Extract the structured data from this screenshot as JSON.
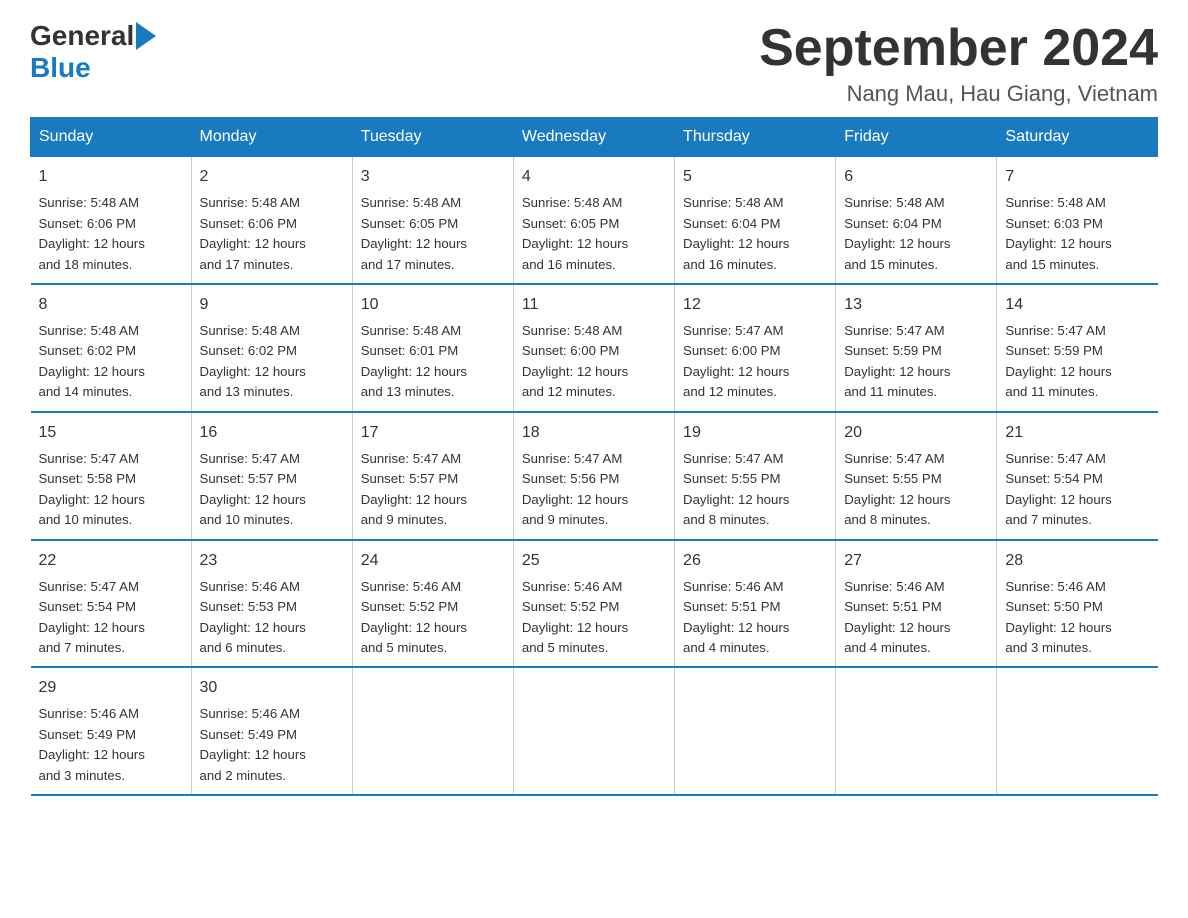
{
  "logo": {
    "text_general": "General",
    "text_blue": "Blue",
    "arrow_symbol": "▶"
  },
  "title": "September 2024",
  "subtitle": "Nang Mau, Hau Giang, Vietnam",
  "days_of_week": [
    "Sunday",
    "Monday",
    "Tuesday",
    "Wednesday",
    "Thursday",
    "Friday",
    "Saturday"
  ],
  "weeks": [
    [
      {
        "day": "1",
        "sunrise": "5:48 AM",
        "sunset": "6:06 PM",
        "daylight": "12 hours and 18 minutes."
      },
      {
        "day": "2",
        "sunrise": "5:48 AM",
        "sunset": "6:06 PM",
        "daylight": "12 hours and 17 minutes."
      },
      {
        "day": "3",
        "sunrise": "5:48 AM",
        "sunset": "6:05 PM",
        "daylight": "12 hours and 17 minutes."
      },
      {
        "day": "4",
        "sunrise": "5:48 AM",
        "sunset": "6:05 PM",
        "daylight": "12 hours and 16 minutes."
      },
      {
        "day": "5",
        "sunrise": "5:48 AM",
        "sunset": "6:04 PM",
        "daylight": "12 hours and 16 minutes."
      },
      {
        "day": "6",
        "sunrise": "5:48 AM",
        "sunset": "6:04 PM",
        "daylight": "12 hours and 15 minutes."
      },
      {
        "day": "7",
        "sunrise": "5:48 AM",
        "sunset": "6:03 PM",
        "daylight": "12 hours and 15 minutes."
      }
    ],
    [
      {
        "day": "8",
        "sunrise": "5:48 AM",
        "sunset": "6:02 PM",
        "daylight": "12 hours and 14 minutes."
      },
      {
        "day": "9",
        "sunrise": "5:48 AM",
        "sunset": "6:02 PM",
        "daylight": "12 hours and 13 minutes."
      },
      {
        "day": "10",
        "sunrise": "5:48 AM",
        "sunset": "6:01 PM",
        "daylight": "12 hours and 13 minutes."
      },
      {
        "day": "11",
        "sunrise": "5:48 AM",
        "sunset": "6:00 PM",
        "daylight": "12 hours and 12 minutes."
      },
      {
        "day": "12",
        "sunrise": "5:47 AM",
        "sunset": "6:00 PM",
        "daylight": "12 hours and 12 minutes."
      },
      {
        "day": "13",
        "sunrise": "5:47 AM",
        "sunset": "5:59 PM",
        "daylight": "12 hours and 11 minutes."
      },
      {
        "day": "14",
        "sunrise": "5:47 AM",
        "sunset": "5:59 PM",
        "daylight": "12 hours and 11 minutes."
      }
    ],
    [
      {
        "day": "15",
        "sunrise": "5:47 AM",
        "sunset": "5:58 PM",
        "daylight": "12 hours and 10 minutes."
      },
      {
        "day": "16",
        "sunrise": "5:47 AM",
        "sunset": "5:57 PM",
        "daylight": "12 hours and 10 minutes."
      },
      {
        "day": "17",
        "sunrise": "5:47 AM",
        "sunset": "5:57 PM",
        "daylight": "12 hours and 9 minutes."
      },
      {
        "day": "18",
        "sunrise": "5:47 AM",
        "sunset": "5:56 PM",
        "daylight": "12 hours and 9 minutes."
      },
      {
        "day": "19",
        "sunrise": "5:47 AM",
        "sunset": "5:55 PM",
        "daylight": "12 hours and 8 minutes."
      },
      {
        "day": "20",
        "sunrise": "5:47 AM",
        "sunset": "5:55 PM",
        "daylight": "12 hours and 8 minutes."
      },
      {
        "day": "21",
        "sunrise": "5:47 AM",
        "sunset": "5:54 PM",
        "daylight": "12 hours and 7 minutes."
      }
    ],
    [
      {
        "day": "22",
        "sunrise": "5:47 AM",
        "sunset": "5:54 PM",
        "daylight": "12 hours and 7 minutes."
      },
      {
        "day": "23",
        "sunrise": "5:46 AM",
        "sunset": "5:53 PM",
        "daylight": "12 hours and 6 minutes."
      },
      {
        "day": "24",
        "sunrise": "5:46 AM",
        "sunset": "5:52 PM",
        "daylight": "12 hours and 5 minutes."
      },
      {
        "day": "25",
        "sunrise": "5:46 AM",
        "sunset": "5:52 PM",
        "daylight": "12 hours and 5 minutes."
      },
      {
        "day": "26",
        "sunrise": "5:46 AM",
        "sunset": "5:51 PM",
        "daylight": "12 hours and 4 minutes."
      },
      {
        "day": "27",
        "sunrise": "5:46 AM",
        "sunset": "5:51 PM",
        "daylight": "12 hours and 4 minutes."
      },
      {
        "day": "28",
        "sunrise": "5:46 AM",
        "sunset": "5:50 PM",
        "daylight": "12 hours and 3 minutes."
      }
    ],
    [
      {
        "day": "29",
        "sunrise": "5:46 AM",
        "sunset": "5:49 PM",
        "daylight": "12 hours and 3 minutes."
      },
      {
        "day": "30",
        "sunrise": "5:46 AM",
        "sunset": "5:49 PM",
        "daylight": "12 hours and 2 minutes."
      },
      null,
      null,
      null,
      null,
      null
    ]
  ],
  "labels": {
    "sunrise": "Sunrise:",
    "sunset": "Sunset:",
    "daylight": "Daylight:"
  }
}
